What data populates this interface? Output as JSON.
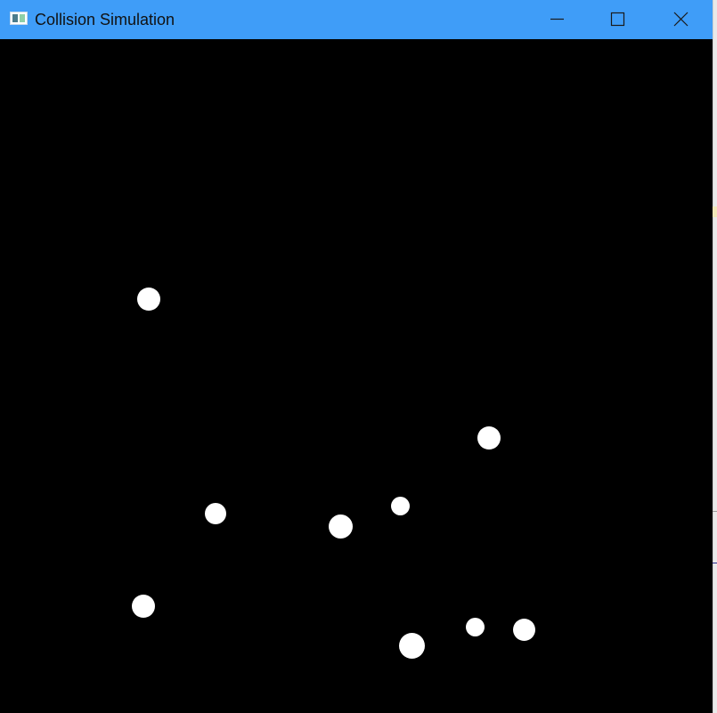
{
  "window": {
    "title": "Collision Simulation",
    "title_bar_color": "#3f9df8",
    "background_color": "#000000",
    "controls": [
      "minimize-icon",
      "maximize-icon",
      "close-icon"
    ]
  },
  "simulation": {
    "ball_color": "#ffffff",
    "ball_count": 9
  }
}
